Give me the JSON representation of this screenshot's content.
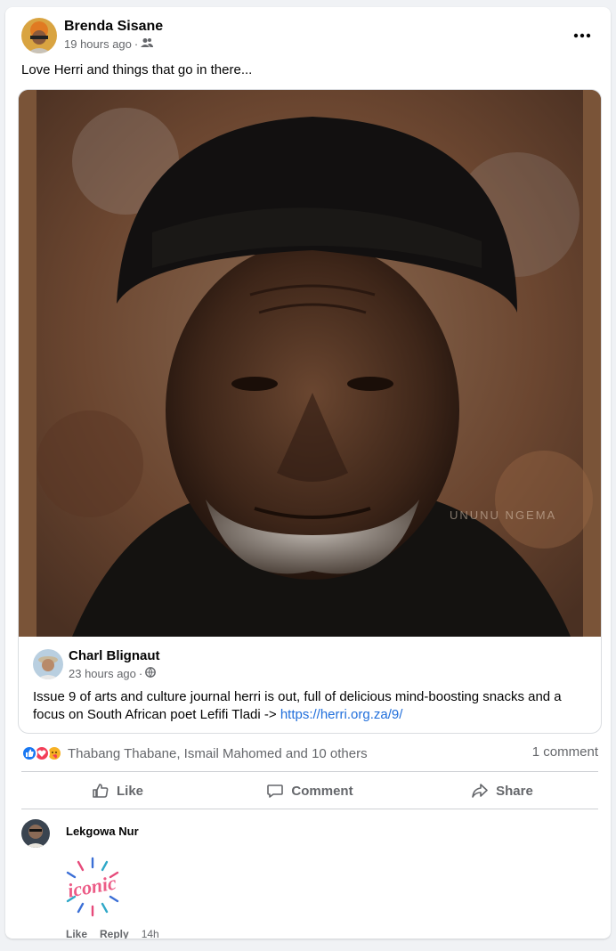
{
  "post": {
    "author": "Brenda Sisane",
    "time": "19 hours ago",
    "separator": "·",
    "text": "Love Herri and things that go in there..."
  },
  "shared": {
    "photo_watermark": "UNUNU NGEMA",
    "author": "Charl Blignaut",
    "time": "23 hours ago",
    "separator": "·",
    "text": "Issue 9 of arts and culture journal herri is out, full of delicious mind-boosting snacks and a focus on South African poet Lefifi Tladi -> ",
    "link": "https://herri.org.za/9/"
  },
  "reactions": {
    "icons": [
      "like-icon",
      "love-icon",
      "care-icon"
    ],
    "names": "Thabang Thabane, Ismail Mahomed and 10 others",
    "comment_count": "1 comment"
  },
  "actions": {
    "like": "Like",
    "comment": "Comment",
    "share": "Share"
  },
  "comment": {
    "author": "Lekgowa Nur",
    "sticker_text": "iconic",
    "like": "Like",
    "reply": "Reply",
    "time": "14h"
  },
  "colors": {
    "link": "#216fdb",
    "secondary_text": "#65676b",
    "like_blue": "#1877f2",
    "love_red": "#f33e58",
    "care_yellow": "#f7b125"
  }
}
